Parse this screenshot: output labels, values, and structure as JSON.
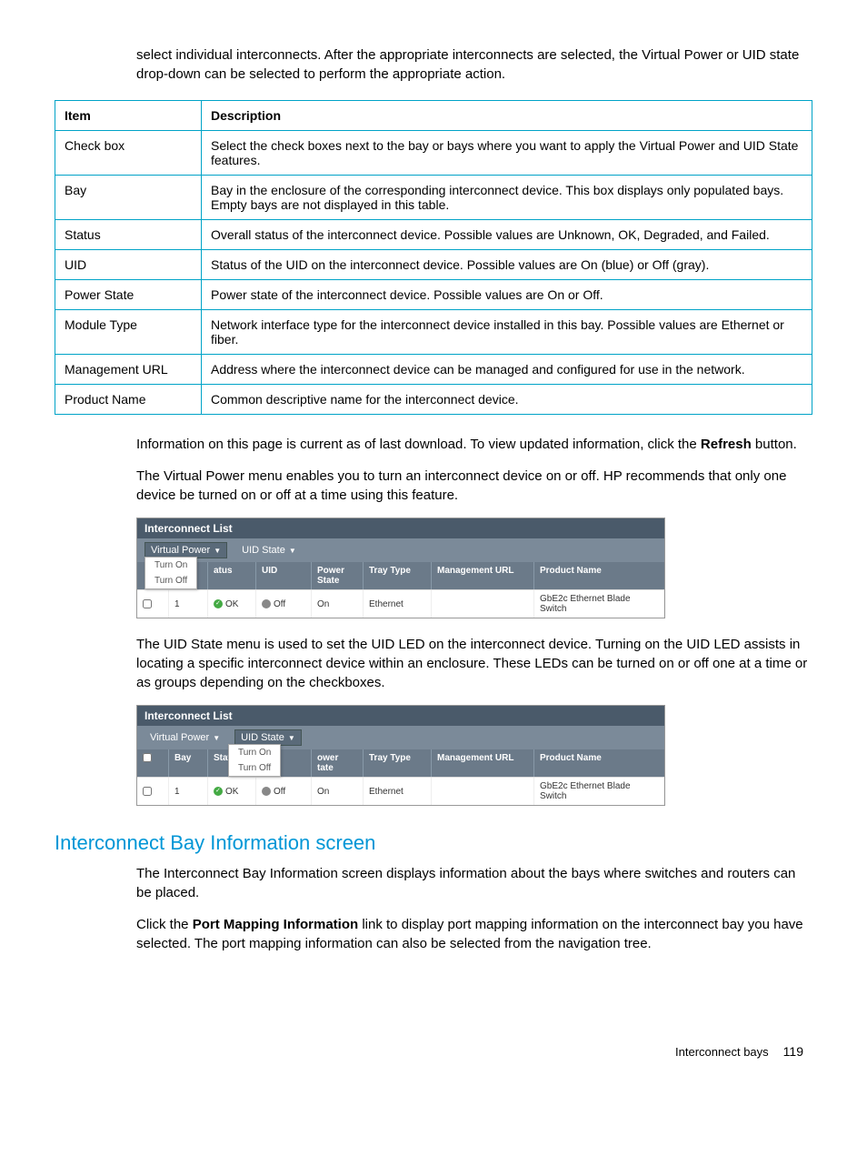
{
  "intro": "select individual interconnects. After the appropriate interconnects are selected, the Virtual Power or UID state drop-down can be selected to perform the appropriate action.",
  "table": {
    "headers": [
      "Item",
      "Description"
    ],
    "rows": [
      [
        "Check box",
        "Select the check boxes next to the bay or bays where you want to apply the Virtual Power and UID State features."
      ],
      [
        "Bay",
        "Bay in the enclosure of the corresponding interconnect device. This box displays only populated bays. Empty bays are not displayed in this table."
      ],
      [
        "Status",
        "Overall status of the interconnect device. Possible values are Unknown, OK, Degraded, and Failed."
      ],
      [
        "UID",
        "Status of the UID on the interconnect device. Possible values are On (blue) or Off (gray)."
      ],
      [
        "Power State",
        "Power state of the interconnect device. Possible values are On or Off."
      ],
      [
        "Module Type",
        "Network interface type for the interconnect device installed in this bay. Possible values are Ethernet or fiber."
      ],
      [
        "Management URL",
        "Address where the interconnect device can be managed and configured for use in the network."
      ],
      [
        "Product Name",
        "Common descriptive name for the interconnect device."
      ]
    ]
  },
  "para_refresh_before": "Information on this page is current as of last download. To view updated information, click the ",
  "refresh_label": "Refresh",
  "para_refresh_after": " button.",
  "para_vp": "The Virtual Power menu enables you to turn an interconnect device on or off. HP recommends that only one device be turned on or off at a time using this feature.",
  "panel_title": "Interconnect List",
  "menu": {
    "virtual_power": "Virtual Power",
    "uid_state": "UID State",
    "turn_on": "Turn On",
    "turn_off": "Turn Off"
  },
  "grid_headers": {
    "bay": "Bay",
    "status": "Status",
    "status_frag": "atus",
    "uid": "UID",
    "power": "Power State",
    "power_frag_top": "ower",
    "power_frag_bot": "tate",
    "tray": "Tray Type",
    "mgmt": "Management URL",
    "prod": "Product Name"
  },
  "row1": {
    "bay": "1",
    "status": "OK",
    "uid": "Off",
    "power": "On",
    "tray": "Ethernet",
    "mgmt": "",
    "prod": "GbE2c Ethernet Blade Switch"
  },
  "para_uid": "The UID State menu is used to set the UID LED on the interconnect device. Turning on the UID LED assists in locating a specific interconnect device within an enclosure. These LEDs can be turned on or off one at a time or as groups depending on the checkboxes.",
  "heading": "Interconnect Bay Information screen",
  "para_heading1": "The Interconnect Bay Information screen displays information about the bays where switches and routers can be placed.",
  "para_pmi_before": "Click the ",
  "pmi_label": "Port Mapping Information",
  "para_pmi_after": " link to display port mapping information on the interconnect bay you have selected. The port mapping information can also be selected from the navigation tree.",
  "footer_label": "Interconnect bays",
  "page_number": "119"
}
